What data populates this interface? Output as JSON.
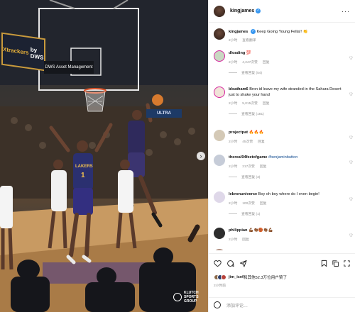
{
  "photo": {
    "ad_sign": {
      "brand_a": "Xtrackers",
      "brand_b": "by DWS"
    },
    "backboard_ad": "DWS Asset Management",
    "arena_banner": "ULTRA",
    "watermark": {
      "line1": "KLUTCH",
      "line2": "SPORTS",
      "line3": "GROUP"
    },
    "jersey_lakers": "LAKERS",
    "jersey_number": "1",
    "next_icon": "chevron-right-icon"
  },
  "header": {
    "username": "kingjames",
    "verified_icon": "verified-badge-icon",
    "more_icon": "more-horizontal-icon",
    "more_label": "···"
  },
  "caption": {
    "username": "kingjames",
    "text": "Keep Going Young Fella!! 👏",
    "time": "2小时",
    "translate": "查看翻译"
  },
  "comments": [
    {
      "username": "dloading",
      "text": "💯",
      "time": "2小时",
      "likes": "4,247次赞",
      "reply": "回复",
      "replies": "查看回复 (54)"
    },
    {
      "username": "bleatham6",
      "text": "Bron id leave my wife stranded in the Sahara Desert just to shake your hand",
      "time": "2小时",
      "likes": "5,015次赞",
      "reply": "回复",
      "replies": "查看回复 (181)"
    },
    {
      "username": "projectpat",
      "text": "🔥🔥🔥",
      "time": "2小时",
      "likes": "45次赞",
      "reply": "回复",
      "replies": ""
    },
    {
      "username": "thereal94feetofgame",
      "text": "#benjaminbutton",
      "time": "2小时",
      "likes": "217次赞",
      "reply": "回复",
      "replies": "查看回复 (3)"
    },
    {
      "username": "lebronuniverse",
      "text": "Boy oh boy where do I even begin!",
      "time": "2小时",
      "likes": "100次赞",
      "reply": "回复",
      "replies": "查看回复 (1)"
    },
    {
      "username": "philippian",
      "text": "💪🏾👏🏾🏀👏🏾💪🏾",
      "time": "2小时",
      "likes": "",
      "reply": "回复",
      "replies": ""
    }
  ],
  "actions": {
    "like_icon": "heart-icon",
    "comment_icon": "comment-icon",
    "share_icon": "send-icon",
    "save_icon": "bookmark-icon",
    "liked_by_user": "jim_icef",
    "liked_by_text": "和其他52.3万位用户赞了",
    "post_time": "2小时前"
  },
  "add_comment": {
    "emoji_icon": "emoji-icon",
    "placeholder": "添加评论…"
  }
}
